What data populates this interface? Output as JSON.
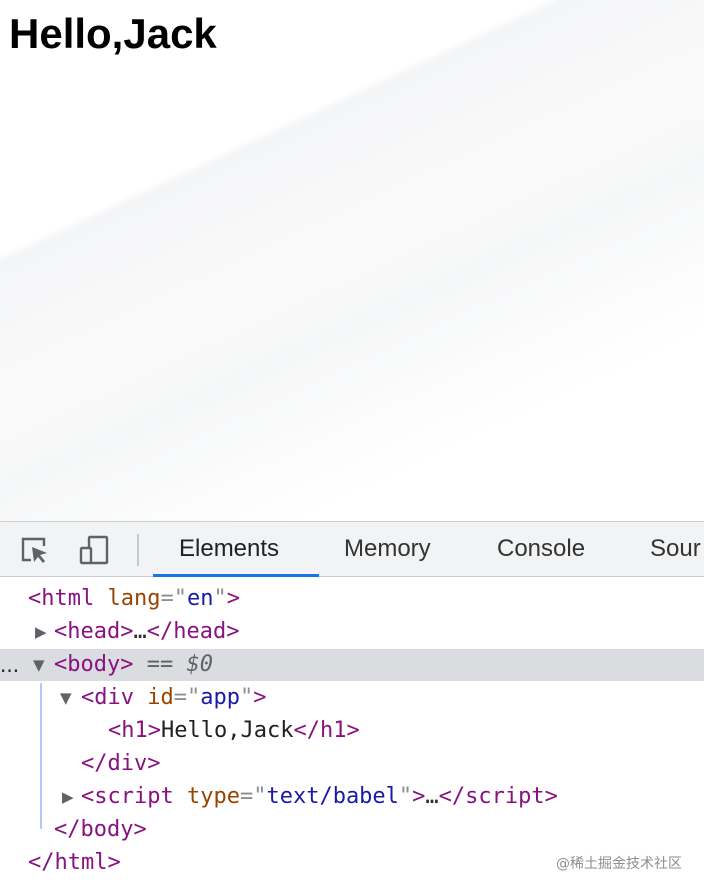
{
  "page": {
    "heading": "Hello,Jack"
  },
  "devtools": {
    "icons": {
      "inspect": "inspect-element-icon",
      "device": "device-toolbar-icon"
    },
    "tabs": [
      {
        "label": "Elements",
        "active": true
      },
      {
        "label": "Memory",
        "active": false
      },
      {
        "label": "Console",
        "active": false
      },
      {
        "label": "Sour",
        "active": false
      }
    ],
    "colors": {
      "active_tab_underline": "#1a73e8",
      "tag": "#881280",
      "attribute_name": "#994500",
      "attribute_value": "#1a1aa6",
      "selected_row": "#dadce0"
    },
    "dom": {
      "html_tag": "html",
      "lang_attr": "lang",
      "lang_val": "en",
      "head_tag": "head",
      "head_close": "/head",
      "ellipsis": "…",
      "row_dots": "...",
      "body_tag": "body",
      "selected_eq": "==",
      "selected_ref": "$0",
      "div_tag": "div",
      "id_attr": "id",
      "id_val": "app",
      "h1_tag": "h1",
      "h1_text": "Hello,Jack",
      "h1_close": "/h1",
      "div_close": "/div",
      "script_tag": "script",
      "type_attr": "type",
      "type_val": "text/babel",
      "script_close": "/script",
      "body_close": "/body",
      "html_close": "/html"
    }
  },
  "watermark": "@稀土掘金技术社区"
}
